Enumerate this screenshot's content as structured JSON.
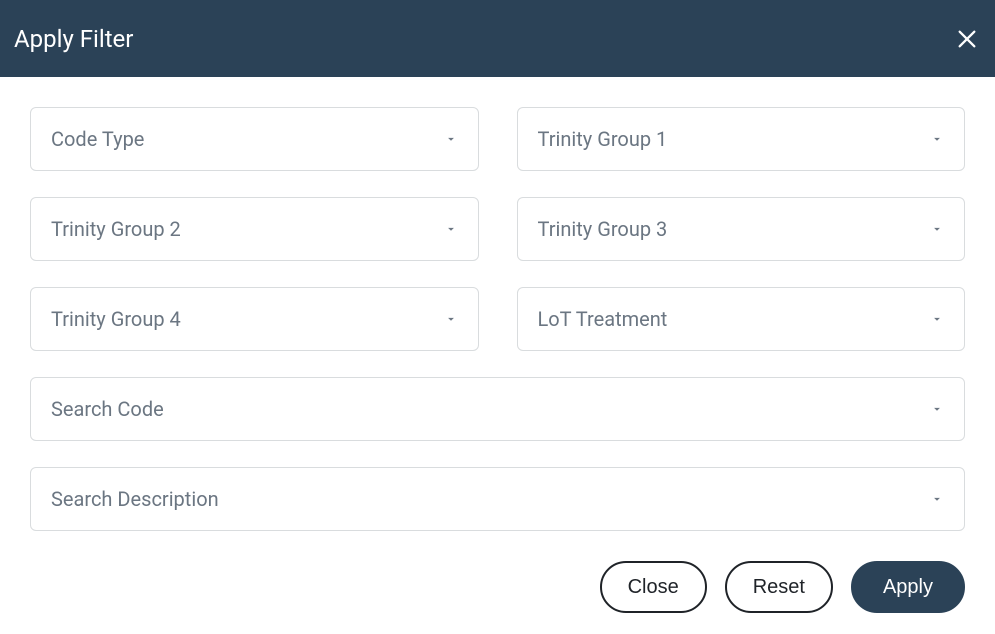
{
  "header": {
    "title": "Apply Filter"
  },
  "fields": {
    "code_type": "Code Type",
    "trinity_group_1": "Trinity Group 1",
    "trinity_group_2": "Trinity Group 2",
    "trinity_group_3": "Trinity Group 3",
    "trinity_group_4": "Trinity Group 4",
    "lot_treatment": "LoT Treatment",
    "search_code": "Search Code",
    "search_description": "Search Description"
  },
  "actions": {
    "close": "Close",
    "reset": "Reset",
    "apply": "Apply"
  }
}
